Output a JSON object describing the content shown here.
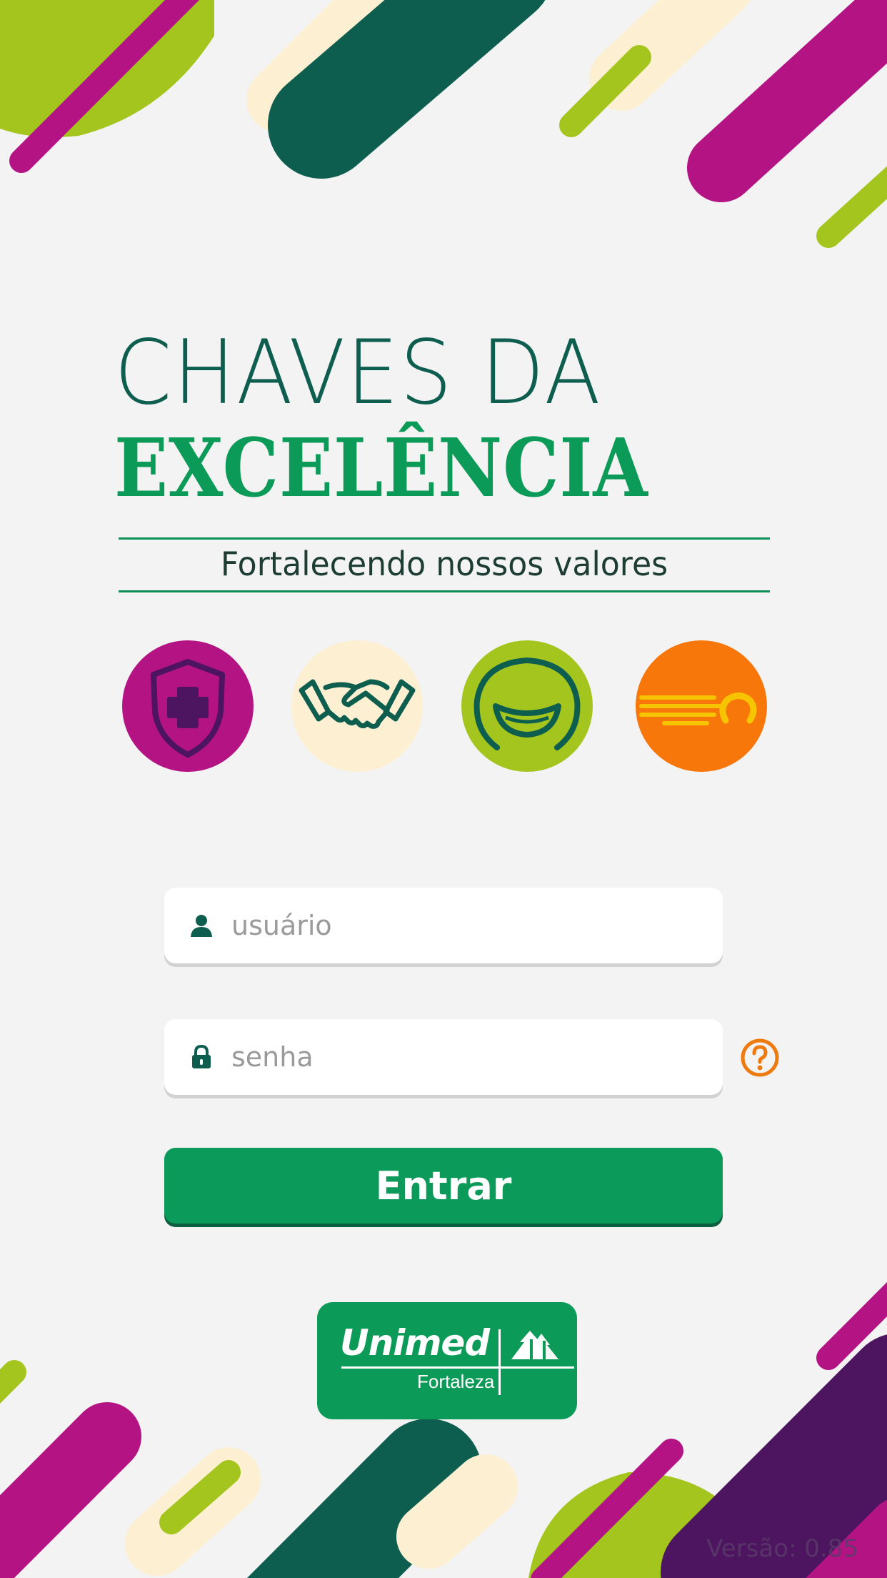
{
  "title": {
    "line1": "CHAVES DA",
    "line2": "EXCELÊNCIA",
    "subtitle": "Fortalecendo nossos valores"
  },
  "values_icons": [
    {
      "icon": "shield-cross-icon",
      "color": "#b41384"
    },
    {
      "icon": "handshake-icon",
      "color": "#fdf0d2"
    },
    {
      "icon": "smile-icon",
      "color": "#a4c51e"
    },
    {
      "icon": "speed-icon",
      "color": "#f8770a"
    }
  ],
  "login": {
    "user_placeholder": "usuário",
    "password_placeholder": "senha",
    "user_icon": "user-icon",
    "password_icon": "lock-icon",
    "help_icon": "question-circle-icon",
    "submit_label": "Entrar"
  },
  "logo": {
    "brand": "Unimed",
    "city": "Fortaleza"
  },
  "version": "Versão: 0.85",
  "colors": {
    "background": "#f3f3f3",
    "primary_green": "#0c9a5a",
    "dark_green": "#0e5e4f",
    "magenta": "#b41384",
    "lime": "#a4c51e",
    "purple": "#4d1560",
    "orange": "#f8770a",
    "cream": "#fdf0d2"
  }
}
